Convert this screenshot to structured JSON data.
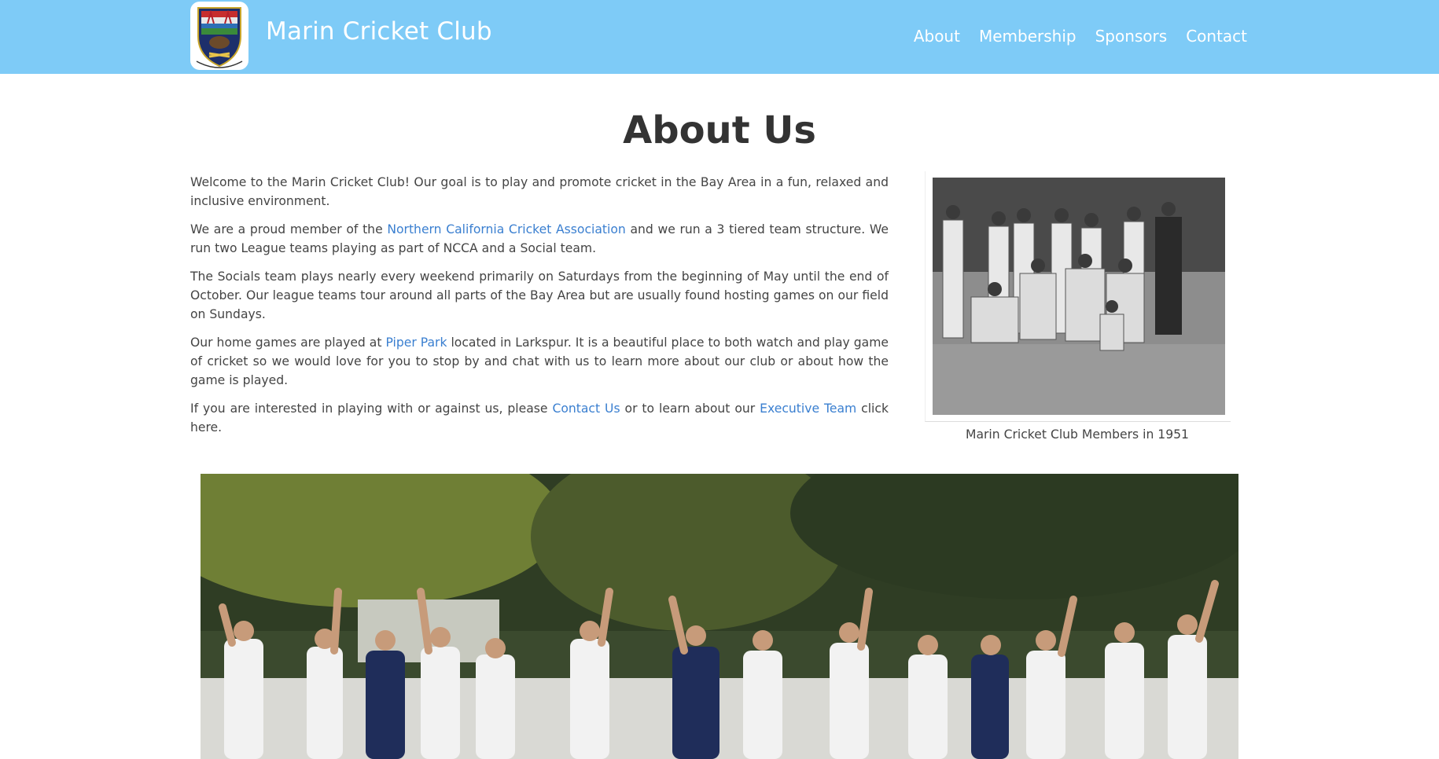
{
  "header": {
    "brand": "Marin Cricket Club",
    "nav": [
      "About",
      "Membership",
      "Sponsors",
      "Contact"
    ],
    "bg_color": "#7ecbf7"
  },
  "main": {
    "title": "About Us",
    "p1": "Welcome to the Marin Cricket Club! Our goal is to play and promote cricket in the Bay Area in a fun, relaxed and inclusive environment.",
    "p2": {
      "before": "We are a proud member of the ",
      "link": "Northern California Cricket Association",
      "after": " and we run a 3 tiered team structure. We run two League teams playing as part of NCCA and a Social team."
    },
    "p3": "The Socials team plays nearly every weekend primarily on Saturdays from the beginning of May until the end of October. Our league teams tour around all parts of the Bay Area but are usually found hosting games on our field on Sundays.",
    "p4": {
      "before": "Our home games are played at ",
      "link": "Piper Park",
      "after": " located in Larkspur. It is a beautiful place to both watch and play game of cricket so we would love for you to stop by and chat with us to learn more about our club or about how the game is played."
    },
    "p5": {
      "before": "If you are interested in playing with or against us, please ",
      "link1": "Contact Us",
      "middle": " or to learn about our ",
      "link2": "Executive Team",
      "after": " click here."
    },
    "link_color": "#3a7fd0"
  },
  "figure": {
    "caption": "Marin Cricket Club Members in 1951"
  },
  "icons": {
    "logo": "club-crest-icon",
    "historic_photo": "team-photo-1951",
    "team_photo": "team-photo-celebration"
  }
}
